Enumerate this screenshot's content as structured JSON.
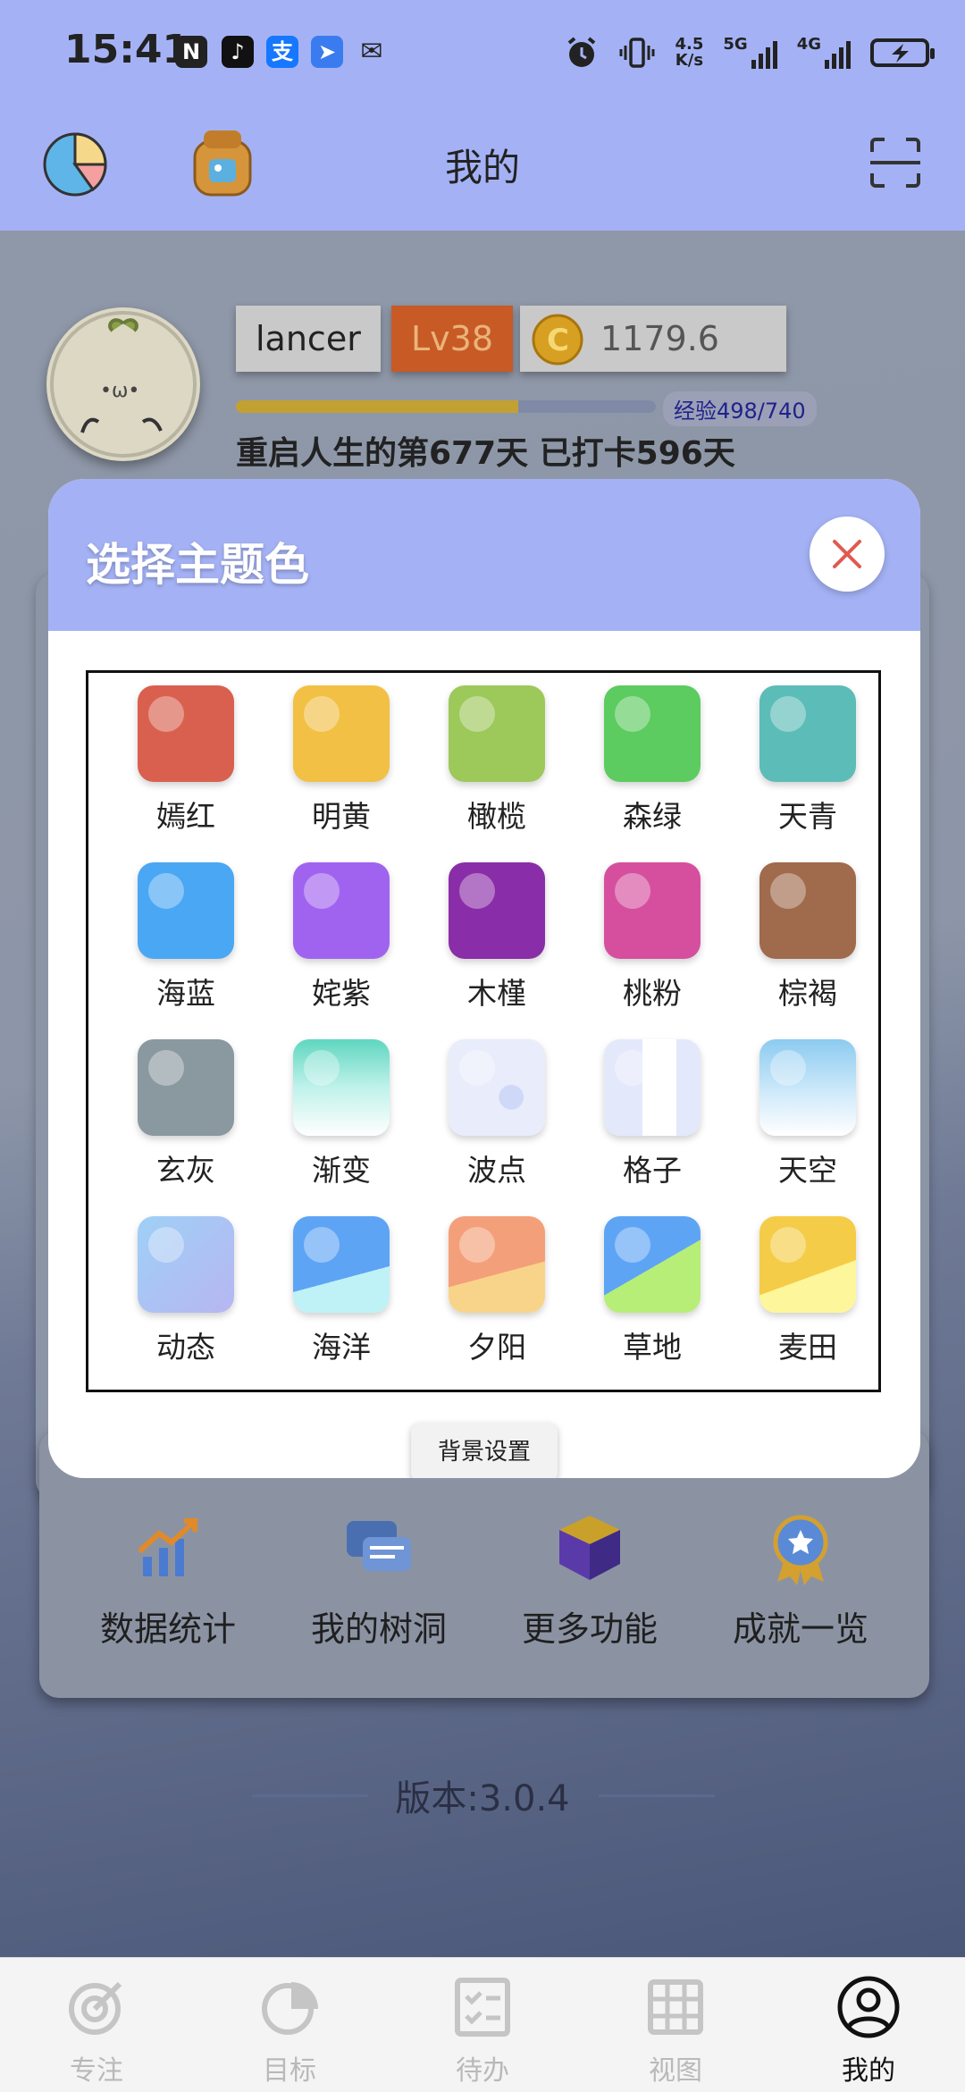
{
  "status_bar": {
    "time": "15:41",
    "net_speed_value": "4.5",
    "net_speed_unit": "K/s",
    "net1": "5G",
    "net2": "4G",
    "icons": [
      "nfc-icon",
      "tiktok-icon",
      "alipay-icon",
      "feishu-icon",
      "wechat-icon",
      "alarm-icon",
      "vibrate-icon",
      "signal-icon",
      "battery-charging-icon"
    ]
  },
  "header": {
    "title": "我的"
  },
  "profile": {
    "username": "lancer",
    "level": "Lv38",
    "coins": "1179.6",
    "exp_text": "经验498/740",
    "exp_progress": 0.673,
    "days_text": "重启人生的第677天 已打卡596天"
  },
  "modal": {
    "title": "选择主题色",
    "close_icon": "close-icon",
    "bg_settings_label": "背景设置",
    "themes": [
      {
        "name": "嫣红",
        "style": "solid",
        "color": "#d9604f"
      },
      {
        "name": "明黄",
        "style": "solid",
        "color": "#f2c045"
      },
      {
        "name": "橄榄",
        "style": "solid",
        "color": "#9dc85a"
      },
      {
        "name": "森绿",
        "style": "solid",
        "color": "#5ccb60"
      },
      {
        "name": "天青",
        "style": "solid",
        "color": "#5cbcb8"
      },
      {
        "name": "海蓝",
        "style": "solid",
        "color": "#4aa7f3"
      },
      {
        "name": "姹紫",
        "style": "solid",
        "color": "#a063f0"
      },
      {
        "name": "木槿",
        "style": "solid",
        "color": "#8a2da8"
      },
      {
        "name": "桃粉",
        "style": "solid",
        "color": "#d64f9f"
      },
      {
        "name": "棕褐",
        "style": "solid",
        "color": "#a06a4c"
      },
      {
        "name": "玄灰",
        "style": "solid",
        "color": "#8a98a0"
      },
      {
        "name": "渐变",
        "style": "gradient",
        "color": "#5fd6c0"
      },
      {
        "name": "波点",
        "style": "dots",
        "color": "#e4e9fb"
      },
      {
        "name": "格子",
        "style": "grid",
        "color": "#e8ebfb"
      },
      {
        "name": "天空",
        "style": "sky",
        "color": "#8ccbf0"
      },
      {
        "name": "动态",
        "style": "dynamic",
        "color": "#a8c6f5"
      },
      {
        "name": "海洋",
        "style": "ocean",
        "color": "#5ea4f5"
      },
      {
        "name": "夕阳",
        "style": "sunset",
        "color": "#f3a07a"
      },
      {
        "name": "草地",
        "style": "grass",
        "color": "#5ea4f5"
      },
      {
        "name": "麦田",
        "style": "wheat",
        "color": "#f5cc48"
      }
    ]
  },
  "features": [
    {
      "label": "数据统计",
      "icon": "chart-icon"
    },
    {
      "label": "我的树洞",
      "icon": "chat-icon"
    },
    {
      "label": "更多功能",
      "icon": "cube-icon"
    },
    {
      "label": "成就一览",
      "icon": "medal-icon"
    }
  ],
  "version": "版本:3.0.4",
  "bottom_nav": [
    {
      "label": "专注",
      "icon": "focus-icon",
      "active": false
    },
    {
      "label": "目标",
      "icon": "pie-icon",
      "active": false
    },
    {
      "label": "待办",
      "icon": "checklist-icon",
      "active": false
    },
    {
      "label": "视图",
      "icon": "grid-icon",
      "active": false
    },
    {
      "label": "我的",
      "icon": "profile-icon",
      "active": true
    }
  ],
  "colors": {
    "accent": "#a4b2f5",
    "exp_fill": "#c2a132",
    "close": "#e05a50"
  }
}
